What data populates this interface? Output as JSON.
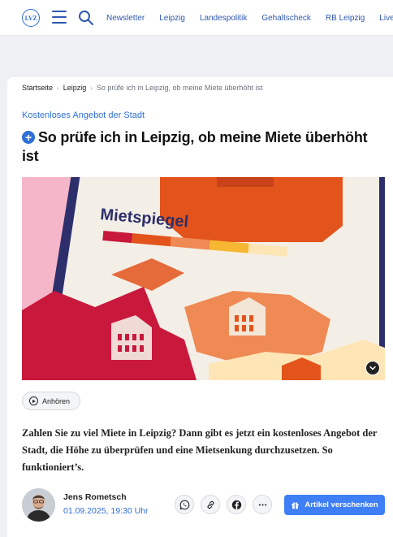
{
  "header": {
    "logo_text": "LVZ",
    "nav": [
      "Newsletter",
      "Leipzig",
      "Landespolitik",
      "Gehaltscheck",
      "RB Leipzig",
      "Live-Fu"
    ]
  },
  "breadcrumb": {
    "home": "Startseite",
    "section": "Leipzig",
    "current": "So prüfe ich in Leipzig, ob meine Miete überhöht ist"
  },
  "article": {
    "kicker": "Kostenloses Angebot der Stadt",
    "plus_badge": "+",
    "headline": "So prüfe ich in Leipzig, ob meine Miete überhöht ist",
    "hero_label": "Mietspiegel",
    "listen_label": "Anhören",
    "teaser": "Zahlen Sie zu viel Miete in Leipzig? Dann gibt es jetzt ein kostenloses Angebot der Stadt, die Höhe zu überprüfen und eine Mietsenkung durchzusetzen. So funktioniert’s."
  },
  "author": {
    "name": "Jens Rometsch",
    "date": "01.09.2025, 19:30 Uhr"
  },
  "actions": {
    "gift_label": "Artikel verschenken",
    "share_icons": [
      "whatsapp-icon",
      "link-icon",
      "facebook-icon",
      "more-icon"
    ]
  },
  "colors": {
    "accent": "#2f6fd6",
    "button": "#3f7ff5",
    "page_bg": "#eef0f4"
  }
}
